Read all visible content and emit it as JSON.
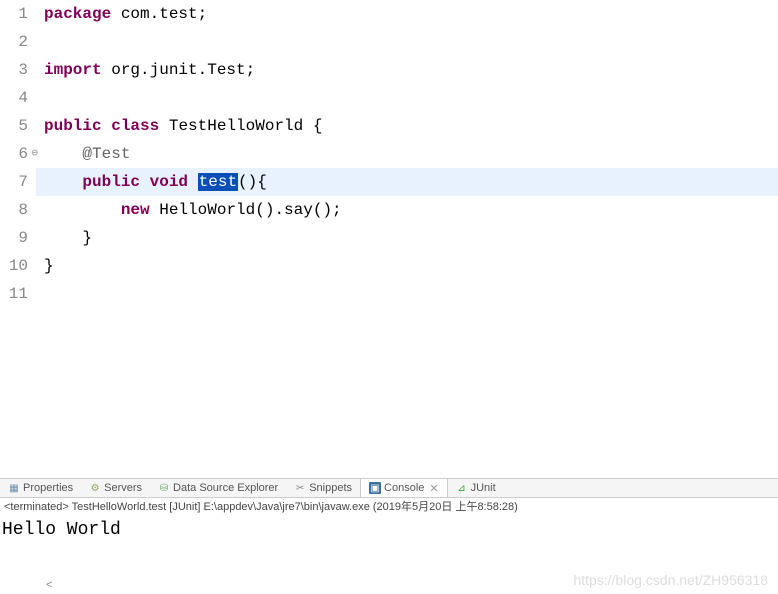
{
  "editor": {
    "lines": [
      {
        "n": "1",
        "segments": [
          [
            "kw",
            "package"
          ],
          [
            "plain",
            " com.test;"
          ]
        ]
      },
      {
        "n": "2",
        "segments": []
      },
      {
        "n": "3",
        "segments": [
          [
            "kw",
            "import"
          ],
          [
            "plain",
            " org.junit.Test;"
          ]
        ]
      },
      {
        "n": "4",
        "segments": []
      },
      {
        "n": "5",
        "segments": [
          [
            "kw",
            "public"
          ],
          [
            "plain",
            " "
          ],
          [
            "kw",
            "class"
          ],
          [
            "plain",
            " TestHelloWorld {"
          ]
        ]
      },
      {
        "n": "6",
        "annotated": true,
        "segments": [
          [
            "plain",
            "    "
          ],
          [
            "ann",
            "@Test"
          ]
        ]
      },
      {
        "n": "7",
        "highlighted": true,
        "segments": [
          [
            "plain",
            "    "
          ],
          [
            "kw",
            "public"
          ],
          [
            "plain",
            " "
          ],
          [
            "kw",
            "void"
          ],
          [
            "plain",
            " "
          ],
          [
            "selected",
            "test"
          ],
          [
            "plain",
            "(){"
          ]
        ]
      },
      {
        "n": "8",
        "segments": [
          [
            "plain",
            "        "
          ],
          [
            "kw",
            "new"
          ],
          [
            "plain",
            " HelloWorld().say();"
          ]
        ]
      },
      {
        "n": "9",
        "segments": [
          [
            "plain",
            "    }"
          ]
        ]
      },
      {
        "n": "10",
        "segments": [
          [
            "plain",
            "}"
          ]
        ]
      },
      {
        "n": "11",
        "segments": []
      }
    ],
    "scroll_indicator": "<"
  },
  "tabs": [
    {
      "id": "properties",
      "label": "Properties",
      "iconClass": "icon-properties",
      "iconGlyph": "▦"
    },
    {
      "id": "servers",
      "label": "Servers",
      "iconClass": "icon-servers",
      "iconGlyph": "⚙"
    },
    {
      "id": "data-source",
      "label": "Data Source Explorer",
      "iconClass": "icon-data",
      "iconGlyph": "⛁"
    },
    {
      "id": "snippets",
      "label": "Snippets",
      "iconClass": "icon-snippets",
      "iconGlyph": "✂"
    },
    {
      "id": "console",
      "label": "Console",
      "iconClass": "icon-console",
      "iconGlyph": "▣",
      "active": true,
      "closable": true
    },
    {
      "id": "junit",
      "label": "JUnit",
      "iconClass": "icon-junit",
      "iconGlyph": "⊿"
    }
  ],
  "status": {
    "text": "<terminated> TestHelloWorld.test [JUnit] E:\\appdev\\Java\\jre7\\bin\\javaw.exe (2019年5月20日 上午8:58:28)"
  },
  "console": {
    "output": "Hello World"
  },
  "watermark": "https://blog.csdn.net/ZH956318"
}
